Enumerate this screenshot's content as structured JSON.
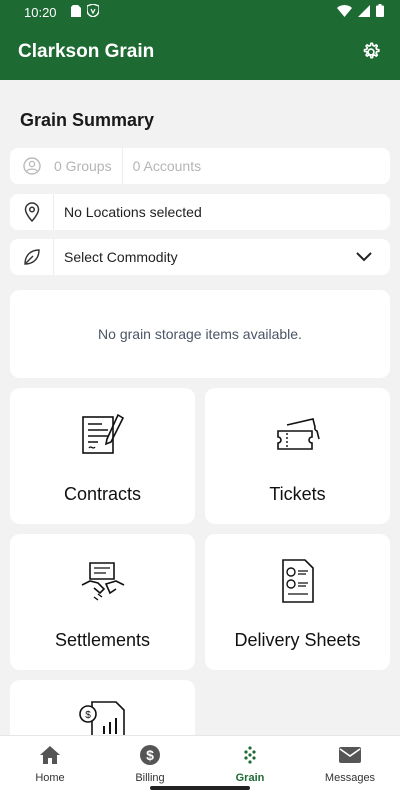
{
  "status_bar": {
    "time": "10:20"
  },
  "app_bar": {
    "title": "Clarkson Grain"
  },
  "summary": {
    "title": "Grain Summary",
    "groups": "0 Groups",
    "accounts": "0 Accounts",
    "location": "No Locations selected",
    "commodity": "Select Commodity",
    "empty_message": "No grain storage items available."
  },
  "tiles": [
    {
      "label": "Contracts",
      "icon": "contract-icon"
    },
    {
      "label": "Tickets",
      "icon": "ticket-icon"
    },
    {
      "label": "Settlements",
      "icon": "handshake-icon"
    },
    {
      "label": "Delivery Sheets",
      "icon": "delivery-sheet-icon"
    },
    {
      "label": "",
      "icon": "report-icon"
    }
  ],
  "nav": [
    {
      "label": "Home",
      "icon": "home-icon"
    },
    {
      "label": "Billing",
      "icon": "dollar-icon"
    },
    {
      "label": "Grain",
      "icon": "grain-icon",
      "active": true
    },
    {
      "label": "Messages",
      "icon": "mail-icon"
    }
  ],
  "colors": {
    "brand": "#1e6a33",
    "background": "#f2f2f2"
  }
}
